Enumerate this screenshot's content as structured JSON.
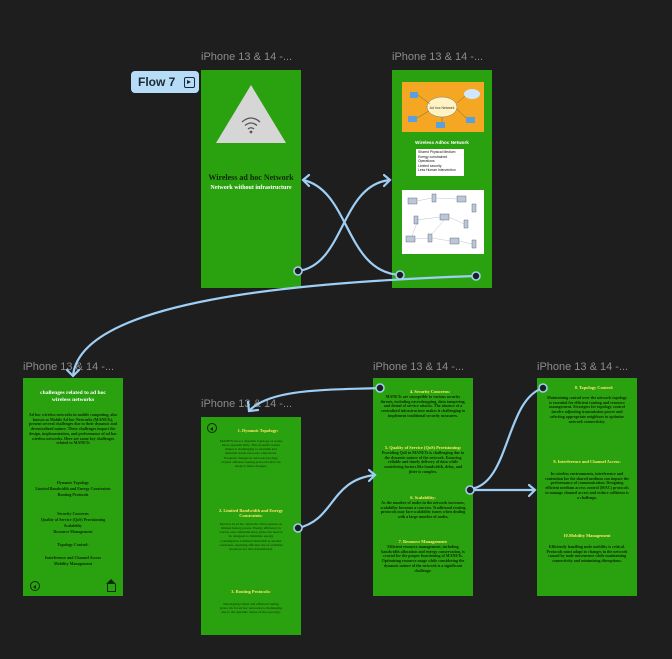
{
  "canvas": {
    "frame_label": "iPhone 13 & 14 -...",
    "flow_label": "Flow 7"
  },
  "frame1": {
    "title": "Wireless ad hoc Network",
    "subtitle": "Network  without infrastructure"
  },
  "frame2": {
    "diagram_caption": "Wireless Adhoc Network",
    "center_label": "Ad hoc Network",
    "bullets": [
      "Shared Physical Medium",
      "Energy     constrained Operations",
      "Limited security",
      "Less Human Intervention"
    ]
  },
  "frame3": {
    "heading": "challenges related to ad hoc wireless networks",
    "intro": "Ad hoc wireless networks in mobile computing, also known as Mobile Ad hoc Networks (MANETs), present several challenges due to their dynamic and decentralized nature. These challenges impact the design, implementation, and performance of ad hoc wireless networks. Here are some key challenges related to MANETs",
    "items": [
      "Dynamic Topology",
      "Limited Bandwidth and Energy Constraints",
      "Routing Protocols",
      "Security Concerns",
      "Quality of Service (QoS) Provisioning",
      "Scalability",
      "Resource Management",
      "Topology Control:",
      "Interference and Channel Access",
      "Mobility Management"
    ]
  },
  "frame4": {
    "s1_title": "1. Dynamic Topology:",
    "s1_body": "MANETs have a dynamic topology as nodes move unpredictably. This dynamic nature makes it challenging to establish and maintain stable network connections. Frequent changes in network topology require efficient routing protocols that can adapt to these changes.",
    "s2_title": "2. Limited Bandwidth and Energy Constraints:",
    "s2_body": "Devices in ad hoc networks often operate on limited battery power. Energy efficiency is crucial, and communication protocols need to be designed to minimize energy consumption. Limited bandwidth is another constraint, requiring efficient use of available resources for data transmission.",
    "s3_title": "3. Routing Protocols:",
    "s3_body": "Developing robust and efficient routing protocols for ad hoc networks is challenging due to the dynamic nature of the topology."
  },
  "frame5": {
    "s4_title": "4. Security Concerns:",
    "s4_body": "MANETs are susceptible to various security threats, including eavesdropping, data tampering, and denial of service attacks. The absence of a centralized infrastructure makes it challenging to implement traditional security measures.",
    "s5_title": "5. Quality of Service (QoS) Provisioning:",
    "s5_body": "Providing QoS in MANETs is challenging due to the dynamic nature of the network. Ensuring reliable and timely delivery of data while considering factors like bandwidth, delay, and jitter is complex.",
    "s6_title": "6. Scalability:",
    "s6_body": "As the number of nodes in the network increases, scalability becomes a concern. Traditional routing protocols may face scalability issues when dealing with a large number of nodes.",
    "s7_title": "7. Resource Management:",
    "s7_body": "Efficient resource management, including bandwidth allocation and energy conservation, is crucial for the proper functioning of MANETs. Optimizing resource usage while considering the dynamic nature of the network is a significant challenge."
  },
  "frame6": {
    "s8_title": "8. Topology Control:",
    "s8_body": "Maintaining control over the network topology is essential for efficient routing and resource management. Strategies for topology control involve adjusting transmission power and selecting appropriate neighbors to optimize network connectivity.",
    "s9_title": "9. Interference and Channel Access:",
    "s9_body": "In wireless environments, interference and contention for the shared medium can impact the performance of communication. Designing efficient medium access control (MAC) protocols to manage channel access and reduce collisions is a challenge.",
    "s10_title": "10.Mobility Management",
    "s10_body": "Efficiently handling node mobility is critical. Protocols must adapt to changes in the network caused by node movements while maintaining connectivity and minimizing disruptions."
  },
  "colors": {
    "canvas": "#1e1e1e",
    "frame_green": "#2aa10f",
    "connector": "#9fcff5",
    "heading_yellow": "#ffe766"
  }
}
